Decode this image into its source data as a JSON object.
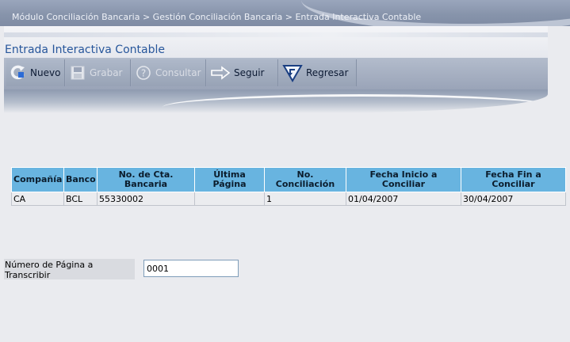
{
  "breadcrumb": "Módulo Conciliación Bancaria > Gestión Conciliación Bancaria > Entrada Interactiva Contable",
  "page_title": "Entrada Interactiva Contable",
  "toolbar": {
    "nuevo": "Nuevo",
    "grabar": "Grabar",
    "consultar": "Consultar",
    "seguir": "Seguir",
    "regresar": "Regresar"
  },
  "table": {
    "headers": [
      "Compañía",
      "Banco",
      "No. de Cta. Bancaria",
      "Última Página",
      "No. Conciliación",
      "Fecha Inicio a Conciliar",
      "Fecha Fin a Conciliar"
    ],
    "rows": [
      [
        "CA",
        "BCL",
        "55330002",
        "",
        "1",
        "01/04/2007",
        "30/04/2007"
      ]
    ]
  },
  "page_field": {
    "label": "Número de Página a Transcribir",
    "value": "0001"
  },
  "colors": {
    "title": "#27569b",
    "table_header": "#68b4e0",
    "toolbar": "#9aa4b8"
  }
}
